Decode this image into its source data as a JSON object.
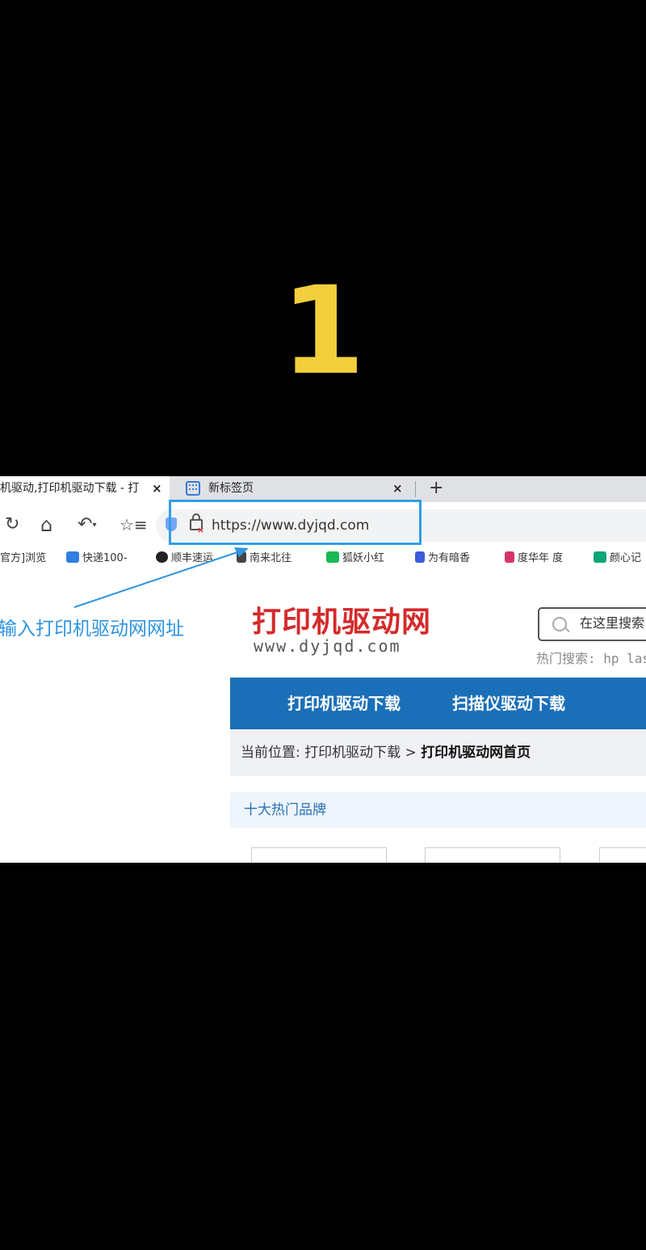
{
  "step_number": "1",
  "browser": {
    "tabs": [
      {
        "title": "机驱动,打印机驱动下载 - 打",
        "active": true
      },
      {
        "title": "新标签页",
        "active": false
      }
    ],
    "close_glyph": "×",
    "new_tab_glyph": "+",
    "address_url": "https://www.dyjqd.com",
    "toolbar_icons": [
      "refresh-icon",
      "home-icon",
      "undo-icon",
      "favorites-icon"
    ],
    "bookmarks": [
      {
        "label": "官方]浏览",
        "color": "#cccccc"
      },
      {
        "label": "快递100-",
        "color": "#2f7fe0"
      },
      {
        "label": "顺丰速运",
        "color": "#222222"
      },
      {
        "label": "南来北往",
        "color": "#444444"
      },
      {
        "label": "狐妖小红",
        "color": "#19b955"
      },
      {
        "label": "为有暗香",
        "color": "#3b5bdb"
      },
      {
        "label": "度华年 度",
        "color": "#d6336c"
      },
      {
        "label": "颜心记",
        "color": "#0ca678"
      }
    ]
  },
  "annotation": {
    "text": "输入打印机驱动网网址",
    "color": "#2d95e2"
  },
  "site": {
    "logo_cn": "打印机驱动网",
    "logo_en": "www.dyjqd.com",
    "search_placeholder": "在这里搜索",
    "hot_search": "热门搜索: hp las",
    "nav_items": [
      "打印机驱动下载",
      "扫描仪驱动下载"
    ],
    "breadcrumb_prefix": "当前位置: 打印机驱动下载 > ",
    "breadcrumb_current": "打印机驱动网首页",
    "section_title": "十大热门品牌"
  }
}
